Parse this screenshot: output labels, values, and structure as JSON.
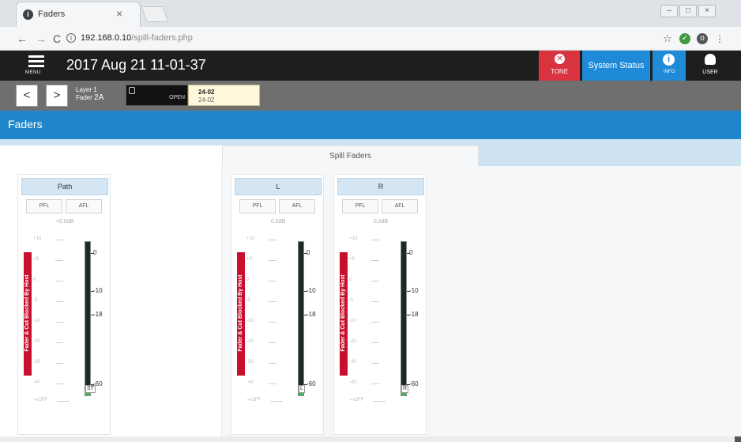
{
  "browser": {
    "tab_title": "Faders",
    "tab_close": "×",
    "url_host": "192.168.0.10",
    "url_path": "/spill-faders.php",
    "window_controls": [
      "–",
      "□",
      "×"
    ]
  },
  "app": {
    "menu_label": "MENU",
    "datetime": "2017 Aug 21 11-01-37",
    "tone_label": "TONE",
    "system_status_label": "System Status",
    "info_label": "INFO",
    "user_label": "USER",
    "accent_color": "#1f86ca",
    "tone_color": "#d9333f"
  },
  "layer": {
    "prev": "<",
    "next": ">",
    "layer_label": "Layer 1",
    "fader_prefix": "Fader",
    "fader_value": "2A",
    "open_label": "OPEN",
    "channel_top": "24-02",
    "channel_bottom": "24-02"
  },
  "page": {
    "title": "Faders",
    "tab_spill": "Spill Faders"
  },
  "strips": [
    {
      "name": "Path",
      "pfl": "PFL",
      "afl": "AFL",
      "gain": "+0.0dB",
      "blocked": "Fader & Cut Blocked By Host",
      "meter_label": "ST"
    },
    {
      "name": "L",
      "pfl": "PFL",
      "afl": "AFL",
      "gain": "0.0dB",
      "blocked": "Fader & Cut Blocked By Host",
      "meter_label": "L"
    },
    {
      "name": "R",
      "pfl": "PFL",
      "afl": "AFL",
      "gain": "0.0dB",
      "blocked": "Fader & Cut Blocked By Host",
      "meter_label": "R"
    }
  ],
  "fader_scale": [
    "+10",
    "+5",
    "0",
    "-5",
    "-10",
    "-20",
    "-30",
    "-40",
    "-∞OFF"
  ],
  "meter_scale": [
    "0",
    "-10",
    "-18",
    "-60"
  ]
}
